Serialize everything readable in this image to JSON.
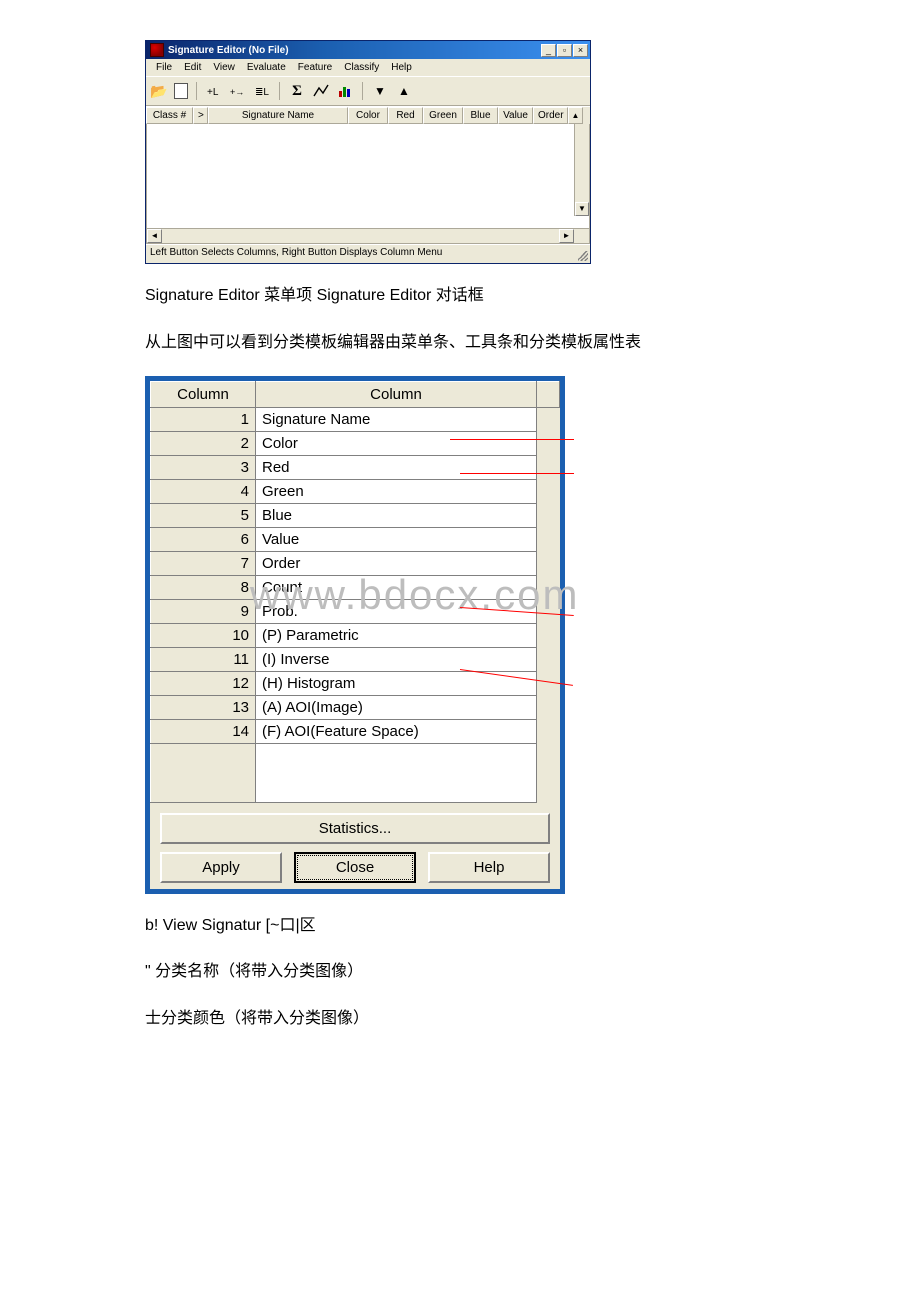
{
  "sig_editor": {
    "title": "Signature Editor (No File)",
    "menu": [
      "File",
      "Edit",
      "View",
      "Evaluate",
      "Feature",
      "Classify",
      "Help"
    ],
    "columns": {
      "class": "Class #",
      "arrow": ">",
      "sig": "Signature Name",
      "color": "Color",
      "red": "Red",
      "green": "Green",
      "blue": "Blue",
      "value": "Value",
      "order": "Order",
      "sb_up": "▲"
    },
    "status": "Left Button Selects Columns, Right Button Displays Column Menu"
  },
  "paragraphs": {
    "p1": "Signature Editor 菜单项 Signature Editor 对话框",
    "p2": "从上图中可以看到分类模板编辑器由菜单条、工具条和分类模板属性表",
    "p3": "b! View Signatur [~口|区",
    "p4": "\" 分类名称（将带入分类图像）",
    "p5": "士分类颜色（将带入分类图像）"
  },
  "cols_dialog": {
    "header_num": "Column",
    "header_name": "Column",
    "rows": [
      {
        "n": "1",
        "name": "Signature Name"
      },
      {
        "n": "2",
        "name": "Color"
      },
      {
        "n": "3",
        "name": "Red"
      },
      {
        "n": "4",
        "name": "Green"
      },
      {
        "n": "5",
        "name": "Blue"
      },
      {
        "n": "6",
        "name": "Value"
      },
      {
        "n": "7",
        "name": "Order"
      },
      {
        "n": "8",
        "name": "Count"
      },
      {
        "n": "9",
        "name": "Prob."
      },
      {
        "n": "10",
        "name": "(P) Parametric"
      },
      {
        "n": "11",
        "name": "(I) Inverse"
      },
      {
        "n": "12",
        "name": "(H) Histogram"
      },
      {
        "n": "13",
        "name": "(A) AOI(Image)"
      },
      {
        "n": "14",
        "name": "(F) AOI(Feature Space)"
      }
    ],
    "statistics_btn": "Statistics...",
    "apply_btn": "Apply",
    "close_btn": "Close",
    "help_btn": "Help"
  },
  "watermark": "www.bdocx.com"
}
